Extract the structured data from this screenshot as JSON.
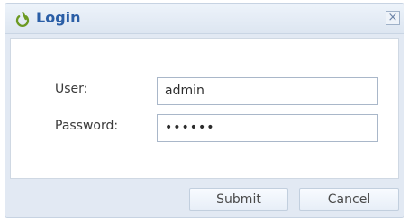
{
  "dialog": {
    "title": "Login",
    "close_glyph": "×",
    "title_icon": "power-icon",
    "accent_color": "#2a5ea6"
  },
  "form": {
    "user_label": "User:",
    "user_value": "admin",
    "password_label": "Password:",
    "password_value": "••••••"
  },
  "buttons": {
    "submit_label": "Submit",
    "cancel_label": "Cancel"
  }
}
